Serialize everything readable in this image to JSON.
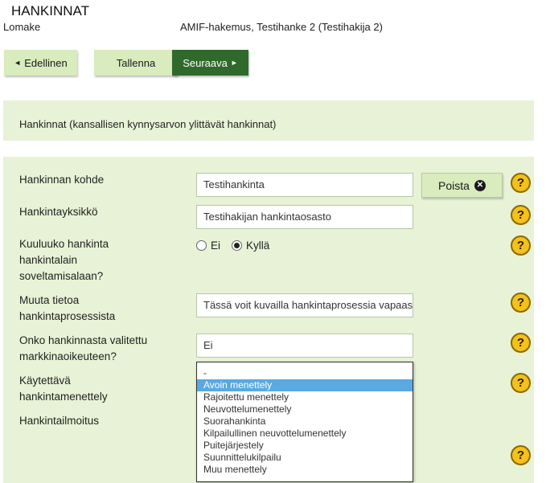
{
  "header": {
    "title": "HANKINNAT",
    "form_label": "Lomake",
    "subtitle": "AMIF-hakemus, Testihanke 2 (Testihakija 2)"
  },
  "toolbar": {
    "prev_label": "Edellinen",
    "save_label": "Tallenna",
    "next_label": "Seuraava"
  },
  "section": {
    "title": "Hankinnat (kansallisen kynnysarvon ylittävät hankinnat)"
  },
  "fields": {
    "subject": {
      "label": "Hankinnan kohde",
      "value": "Testihankinta"
    },
    "unit": {
      "label": "Hankintayksikkö",
      "value": "Testihakijan hankintaosasto"
    },
    "law_scope": {
      "label": "Kuuluuko hankinta hankintalain soveltamisalaan?",
      "options": [
        "Ei",
        "Kyllä"
      ],
      "selected": "Kyllä"
    },
    "process_info": {
      "label": "Muuta tietoa hankintaprosessista",
      "value": "Tässä voit kuvailla hankintaprosessia vapaasti"
    },
    "appeal": {
      "label": "Onko hankinnasta valitettu markkinaoikeuteen?",
      "value": "Ei"
    },
    "procedure": {
      "label": "Käytettävä hankintamenettely",
      "options": [
        "-",
        "Avoin menettely",
        "Rajoitettu menettely",
        "Neuvottelumenettely",
        "Suorahankinta",
        "Kilpailullinen neuvottelumenettely",
        "Puitejärjestely",
        "Suunnittelukilpailu",
        "Muu menettely"
      ],
      "selected_index": 1
    },
    "notice": {
      "label": "Hankintailmoitus"
    }
  },
  "remove_button_label": "Poista",
  "help_symbol": "?",
  "icons": {
    "prev": "triangle-left-icon",
    "next": "triangle-right-icon",
    "remove": "close-circle-icon",
    "help": "help-icon"
  },
  "colors": {
    "panel_bg": "#e8f2d6",
    "button_light": "#d9ecbd",
    "button_dark": "#2f6a2c",
    "help_yellow": "#f5c11a",
    "selected_option": "#5aa9e0"
  }
}
